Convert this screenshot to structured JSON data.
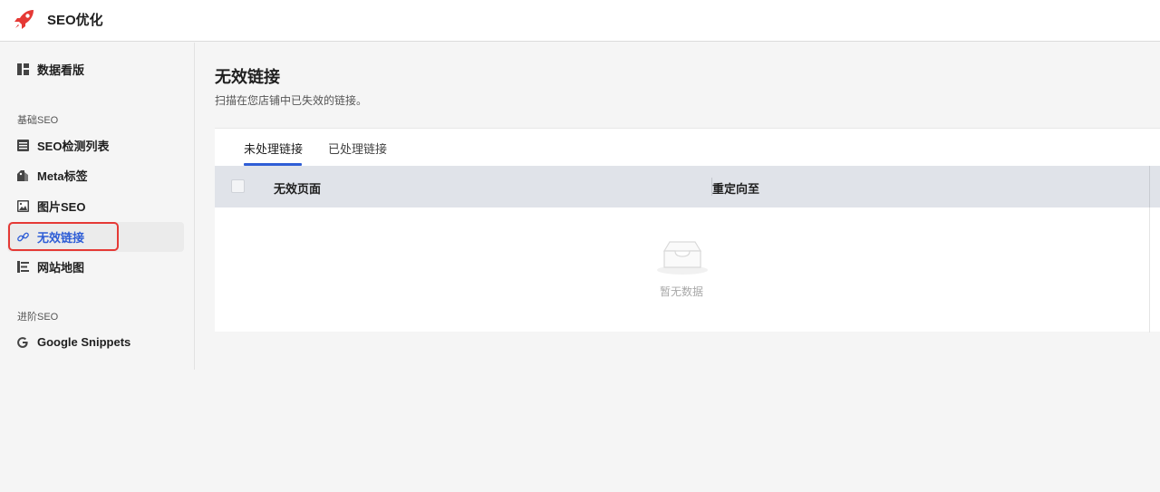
{
  "app": {
    "title": "SEO优化",
    "logo_icon": "rocket-icon",
    "brand_color": "#e53935"
  },
  "sidebar": {
    "items_top": [
      {
        "label": "数据看版",
        "icon": "dashboard-icon"
      }
    ],
    "group_basic": "基础SEO",
    "items_basic": [
      {
        "label": "SEO检测列表",
        "icon": "list-icon"
      },
      {
        "label": "Meta标签",
        "icon": "tag-icon"
      },
      {
        "label": "图片SEO",
        "icon": "image-icon"
      },
      {
        "label": "无效链接",
        "icon": "link-icon",
        "active": true
      },
      {
        "label": "网站地图",
        "icon": "sitemap-icon"
      }
    ],
    "group_advanced": "进阶SEO",
    "items_advanced": [
      {
        "label": "Google Snippets",
        "icon": "google-icon"
      }
    ],
    "active_color": "#2f5ed6"
  },
  "main": {
    "title": "无效链接",
    "description": "扫描在您店铺中已失效的链接。",
    "tabs": [
      {
        "label": "未处理链接",
        "active": true
      },
      {
        "label": "已处理链接",
        "active": false
      }
    ],
    "table": {
      "columns": [
        "无效页面",
        "重定向至"
      ],
      "empty_text": "暂无数据",
      "empty_icon": "empty-inbox-icon"
    }
  }
}
